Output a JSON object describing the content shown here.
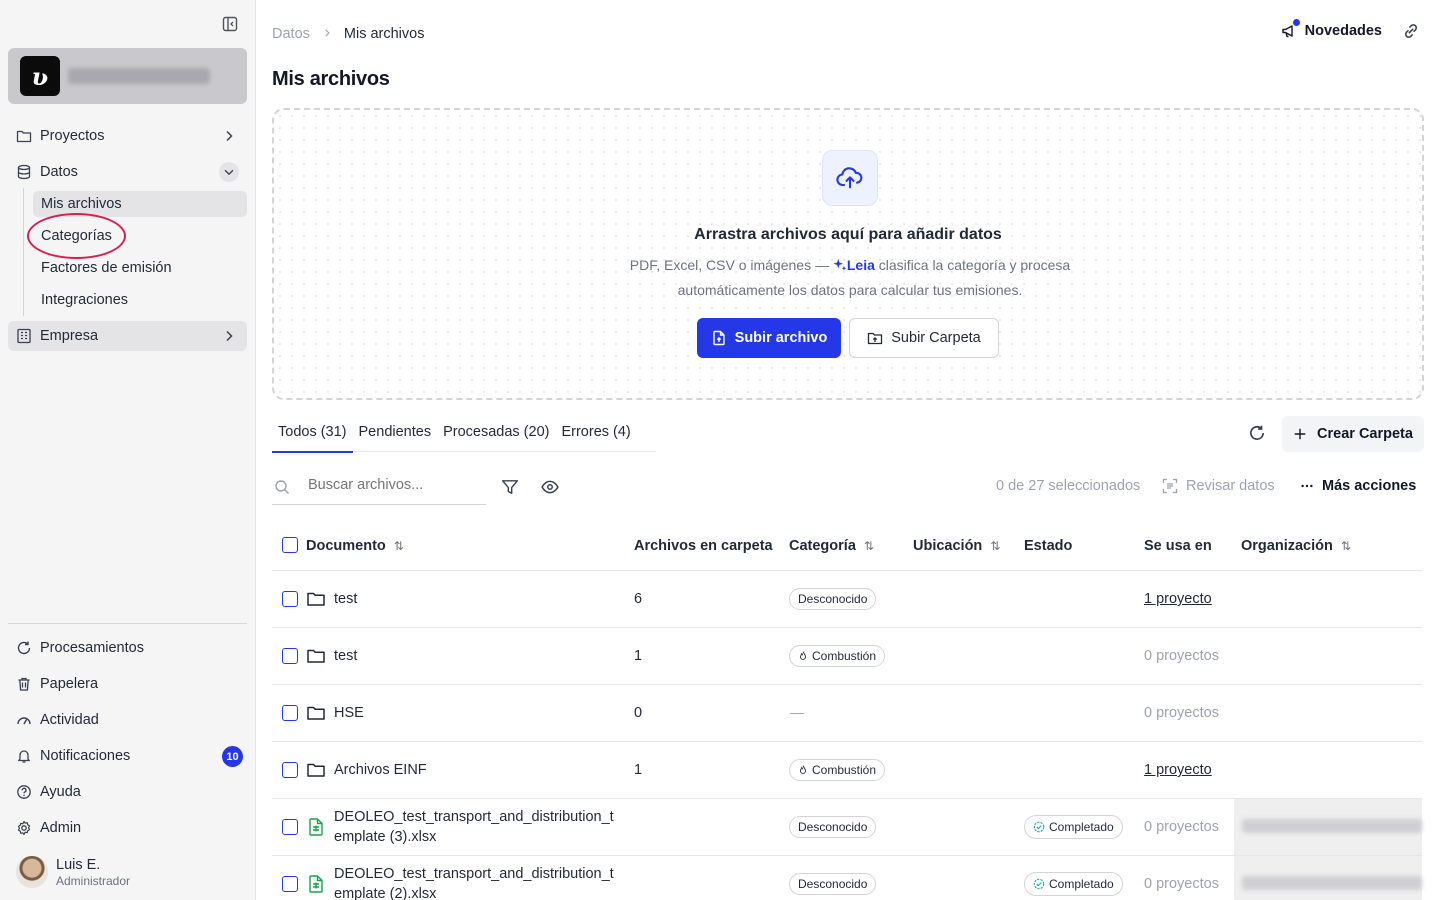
{
  "sidebar": {
    "nav": [
      {
        "label": "Proyectos"
      },
      {
        "label": "Datos"
      },
      {
        "label": "Empresa"
      }
    ],
    "datos_children": [
      {
        "label": "Mis archivos"
      },
      {
        "label": "Categorías"
      },
      {
        "label": "Factores de emisión"
      },
      {
        "label": "Integraciones"
      }
    ],
    "bottom": [
      {
        "label": "Procesamientos"
      },
      {
        "label": "Papelera"
      },
      {
        "label": "Actividad"
      },
      {
        "label": "Notificaciones",
        "badge": "10"
      },
      {
        "label": "Ayuda"
      },
      {
        "label": "Admin"
      }
    ],
    "user": {
      "name": "Luis E.",
      "role": "Administrador"
    }
  },
  "breadcrumb": {
    "parent": "Datos",
    "current": "Mis archivos"
  },
  "header": {
    "novedades": "Novedades"
  },
  "page": {
    "title": "Mis archivos"
  },
  "dropzone": {
    "title": "Arrastra archivos aquí para añadir datos",
    "text_before": "PDF, Excel, CSV o imágenes —",
    "leia": "Leia",
    "text_after": "clasifica la categoría y procesa automáticamente los datos para calcular tus emisiones.",
    "upload_file": "Subir archivo",
    "upload_folder": "Subir Carpeta"
  },
  "tabs": [
    {
      "label": "Todos (31)"
    },
    {
      "label": "Pendientes"
    },
    {
      "label": "Procesadas (20)"
    },
    {
      "label": "Errores (4)"
    }
  ],
  "toolbar": {
    "create_folder": "Crear Carpeta",
    "search_placeholder": "Buscar archivos...",
    "selected": "0 de 27 seleccionados",
    "review": "Revisar datos",
    "more": "Más acciones"
  },
  "table": {
    "headers": {
      "documento": "Documento",
      "archivos": "Archivos en carpeta",
      "categoria": "Categoría",
      "ubicacion": "Ubicación",
      "estado": "Estado",
      "usa": "Se usa en",
      "org": "Organización"
    },
    "rows": [
      {
        "name": "test",
        "count": "6",
        "category": "Desconocido",
        "status": "",
        "used": "1 proyecto"
      },
      {
        "name": "test",
        "count": "1",
        "category": "Combustión",
        "status": "",
        "used": "0 proyectos"
      },
      {
        "name": "HSE",
        "count": "0",
        "category": "—",
        "status": "",
        "used": "0 proyectos"
      },
      {
        "name": "Archivos EINF",
        "count": "1",
        "category": "Combustión",
        "status": "",
        "used": "1 proyecto"
      },
      {
        "name": "DEOLEO_test_transport_and_distribution_template (3).xlsx",
        "count": "",
        "category": "Desconocido",
        "status": "Completado",
        "used": "0 proyectos"
      },
      {
        "name": "DEOLEO_test_transport_and_distribution_template (2).xlsx",
        "count": "",
        "category": "Desconocido",
        "status": "Completado",
        "used": "0 proyectos"
      }
    ]
  },
  "colors": {
    "accent": "#2438e8",
    "highlight": "#d6204e"
  }
}
